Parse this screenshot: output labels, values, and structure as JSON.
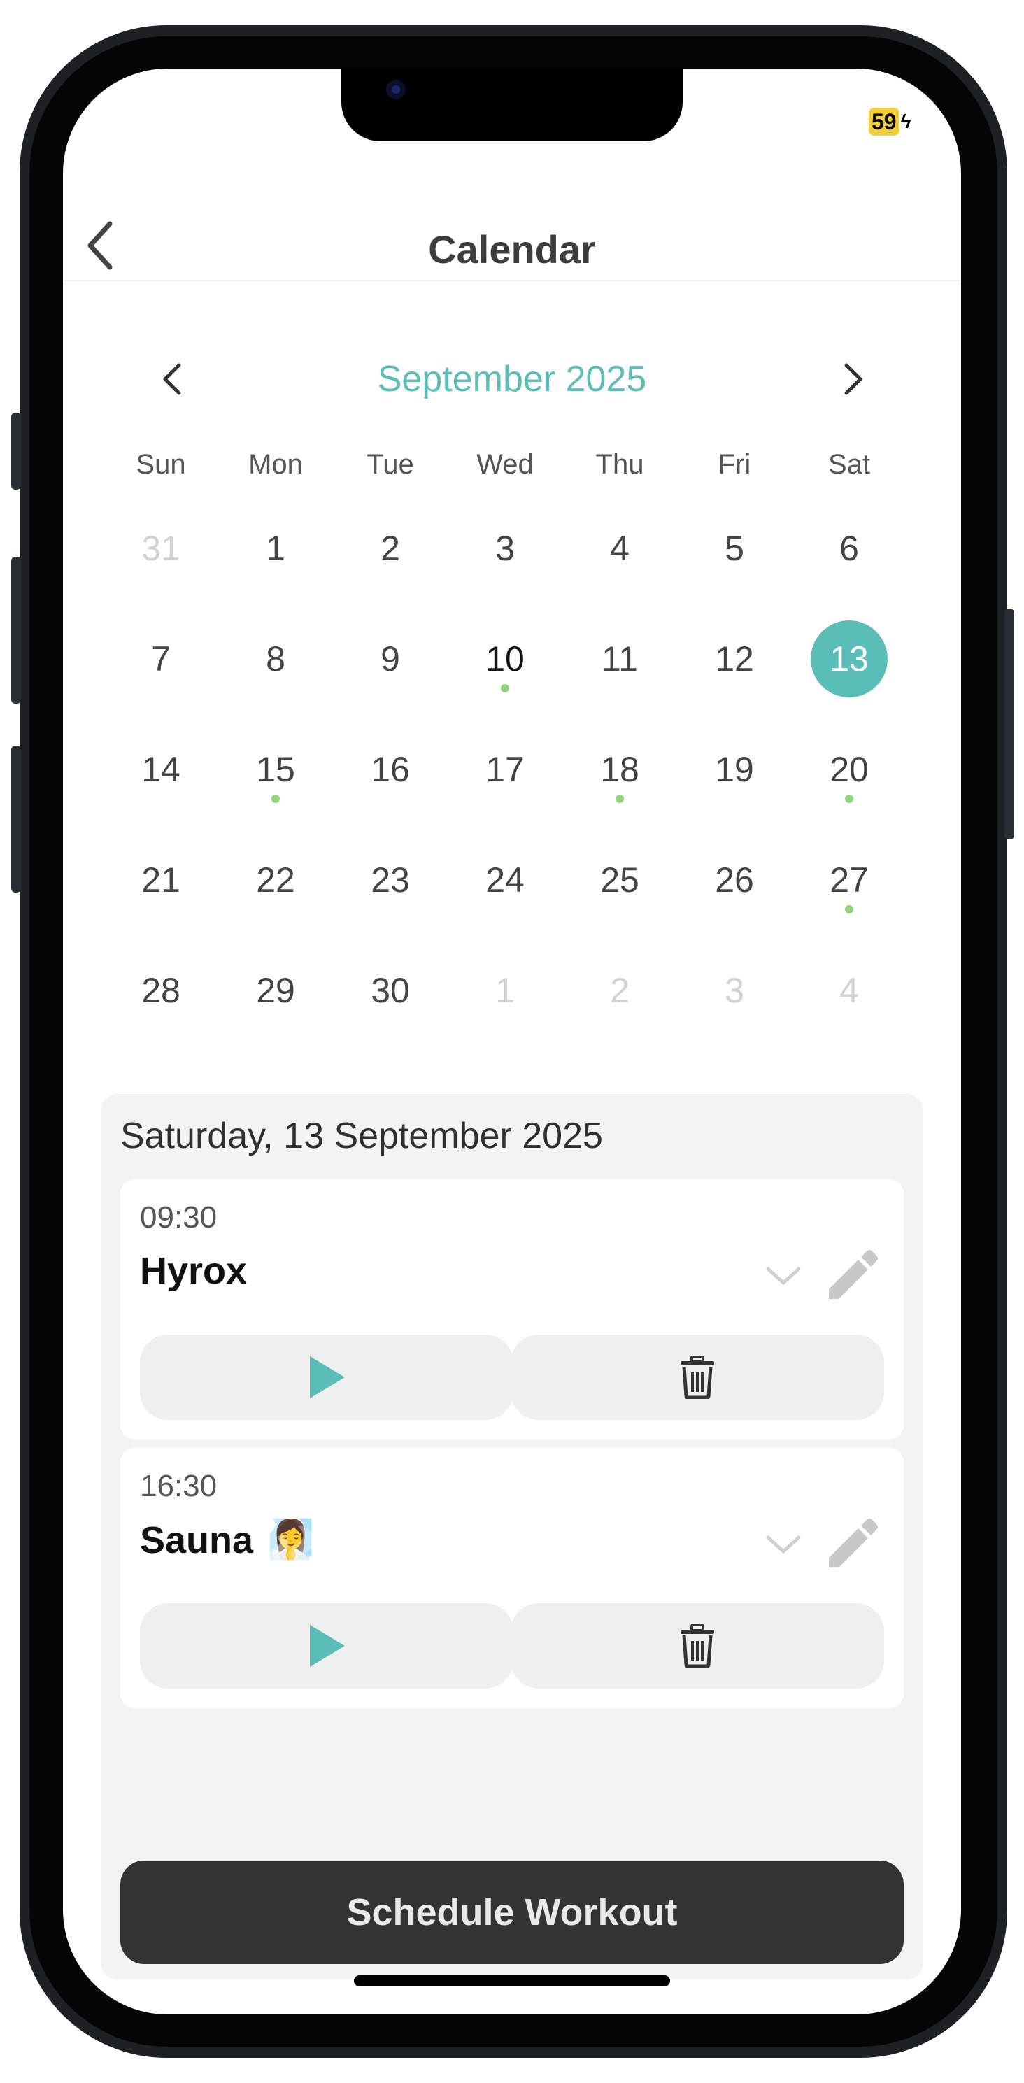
{
  "status": {
    "battery_level": "59"
  },
  "header": {
    "title": "Calendar",
    "back_icon": "chevron-left-icon"
  },
  "calendar": {
    "month_label": "September 2025",
    "weekdays": [
      "Sun",
      "Mon",
      "Tue",
      "Wed",
      "Thu",
      "Fri",
      "Sat"
    ],
    "weeks": [
      [
        "31",
        "1",
        "2",
        "3",
        "4",
        "5",
        "6"
      ],
      [
        "7",
        "8",
        "9",
        "10",
        "11",
        "12",
        "13"
      ],
      [
        "14",
        "15",
        "16",
        "17",
        "18",
        "19",
        "20"
      ],
      [
        "21",
        "22",
        "23",
        "24",
        "25",
        "26",
        "27"
      ],
      [
        "28",
        "29",
        "30",
        "1",
        "2",
        "3",
        "4"
      ]
    ],
    "days_with_events": [
      "10",
      "15",
      "18",
      "20",
      "27"
    ],
    "today": "10",
    "selected": "13",
    "accent_color": "#5bbdb7",
    "event_dot_color": "#8fd47b"
  },
  "day_panel": {
    "date_label": "Saturday, 13 September 2025",
    "workouts": [
      {
        "time": "09:30",
        "title": "Hyrox",
        "emoji": ""
      },
      {
        "time": "16:30",
        "title": "Sauna",
        "emoji": "🧖‍♀️"
      }
    ]
  },
  "actions": {
    "schedule_label": "Schedule Workout"
  }
}
